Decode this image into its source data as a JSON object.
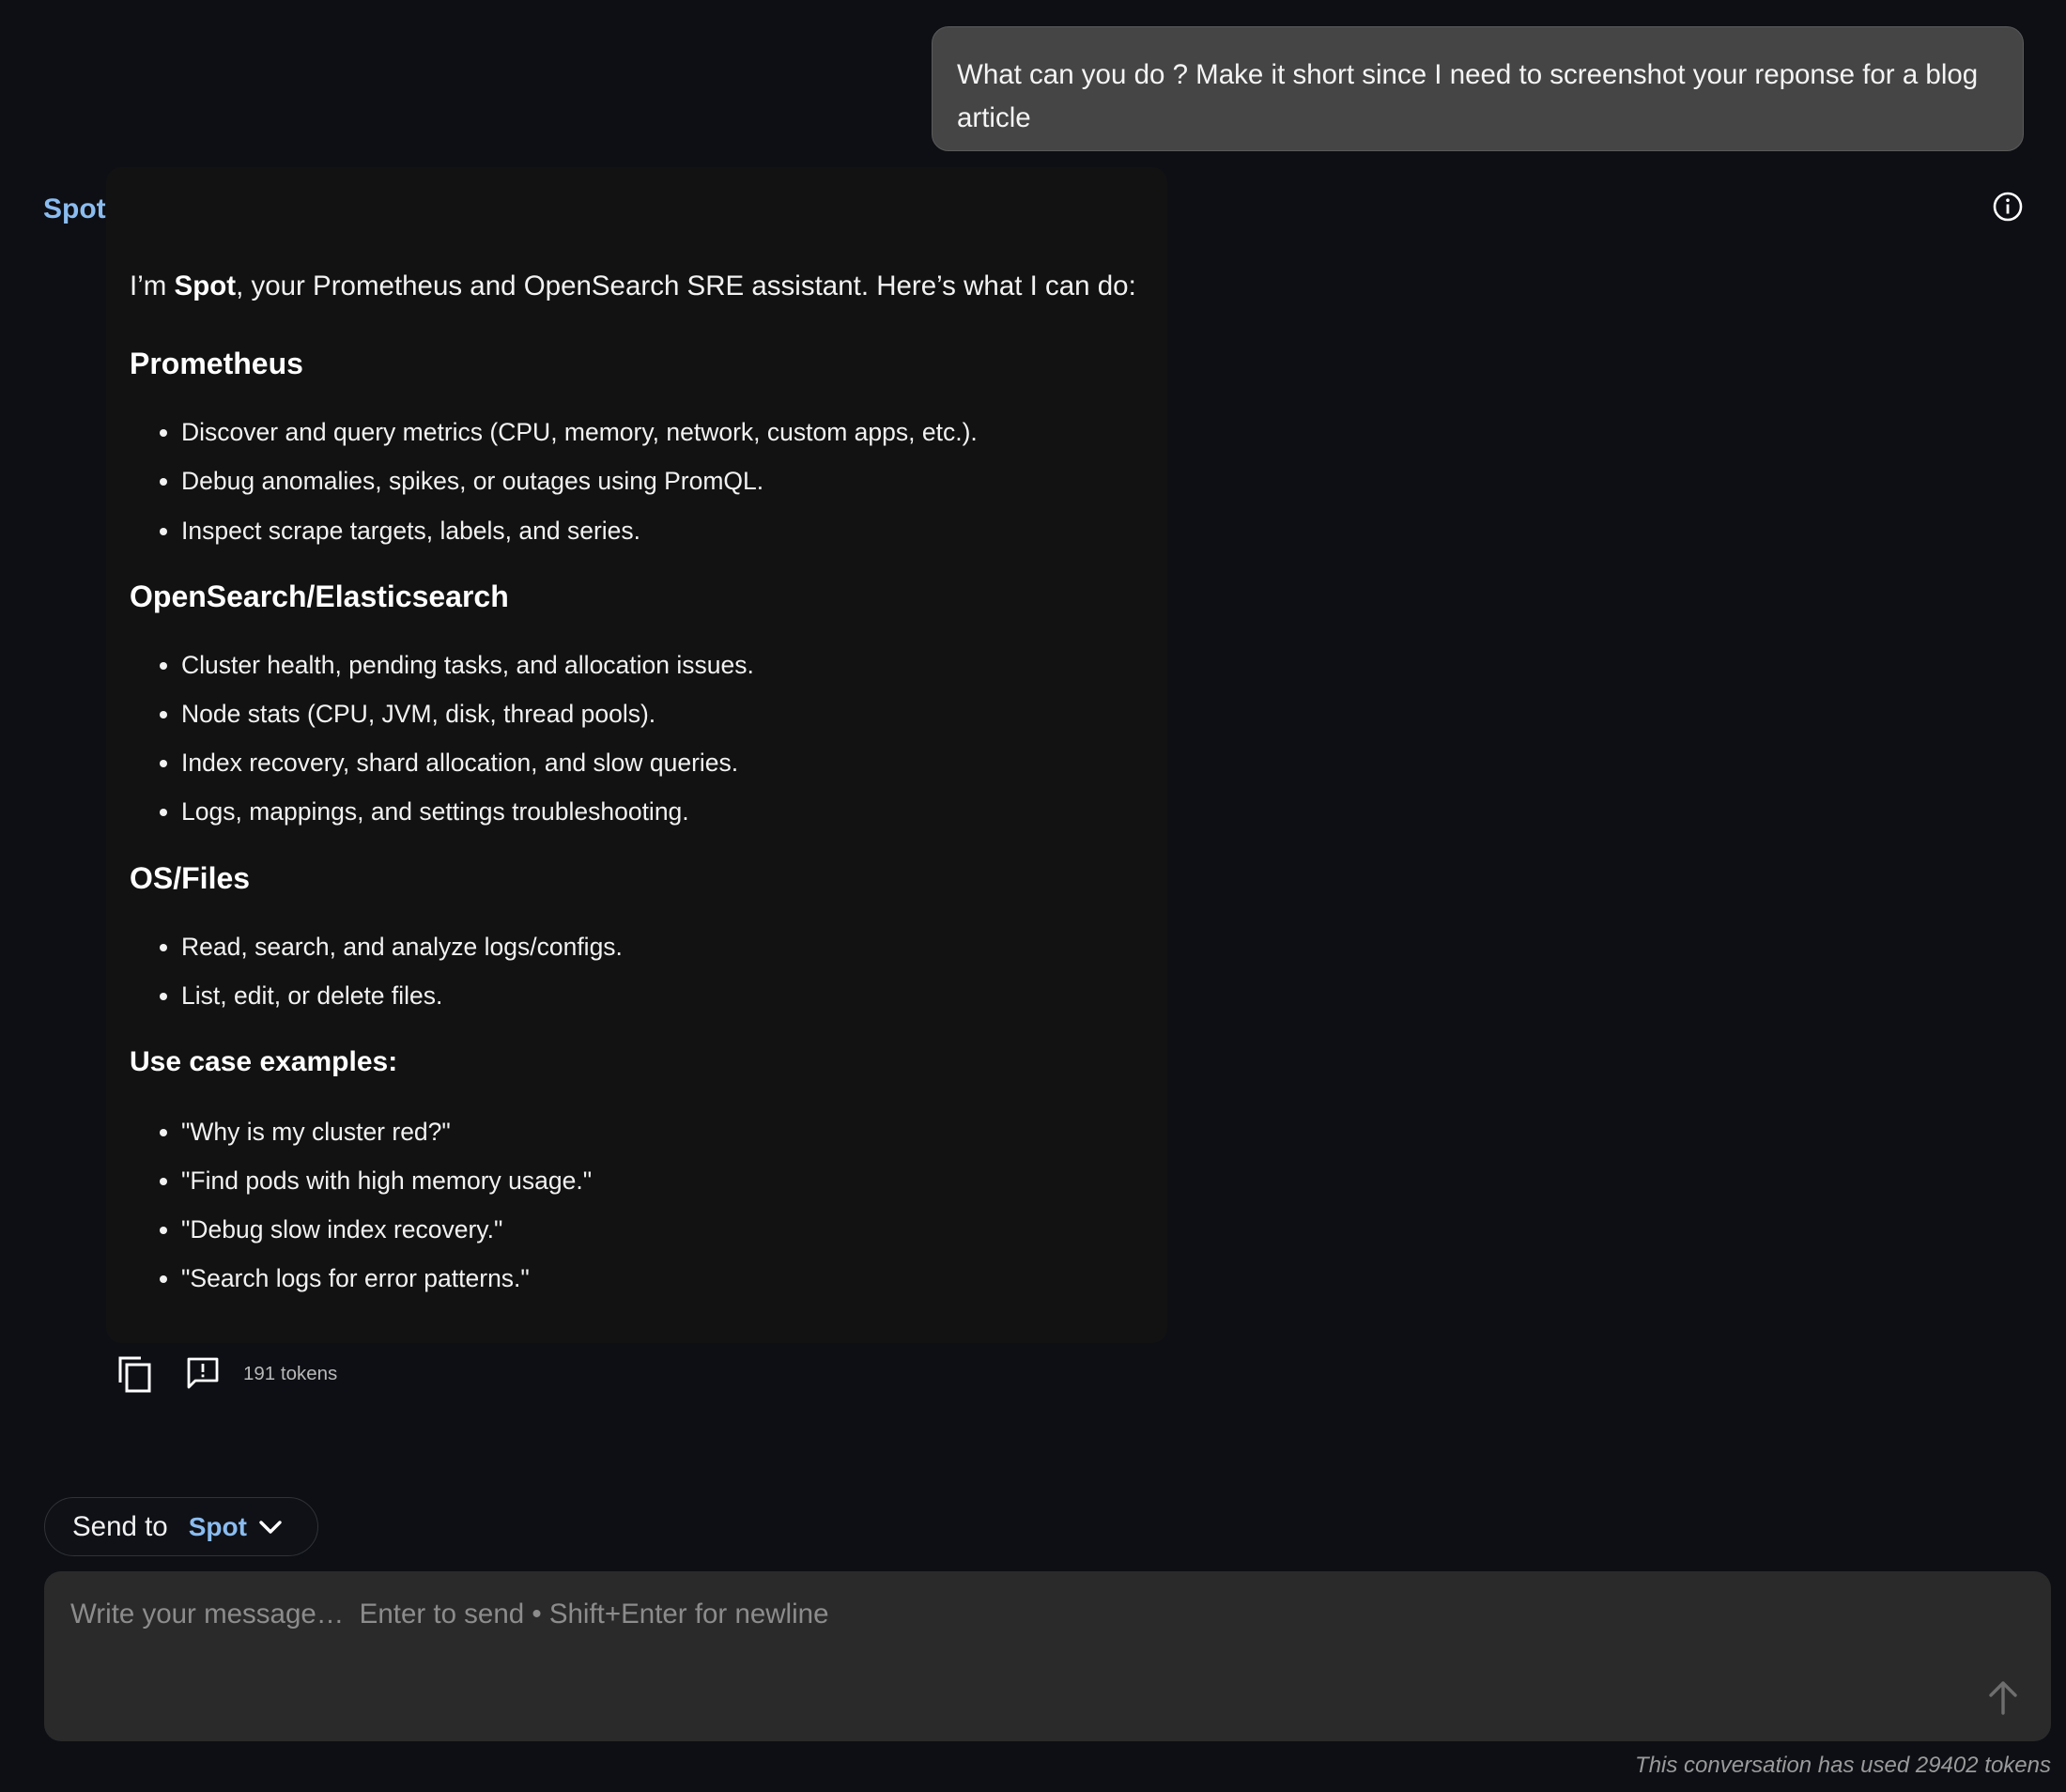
{
  "user_message": {
    "text": "What can you do ? Make it short since I need to screenshot your reponse for a blog article"
  },
  "assistant": {
    "name": "Spot",
    "intro_prefix": "I’m ",
    "intro_bold": "Spot",
    "intro_suffix": ", your Prometheus and OpenSearch SRE assistant. Here’s what I can do:",
    "sections": [
      {
        "heading": "Prometheus",
        "items": [
          "Discover and query metrics (CPU, memory, network, custom apps, etc.).",
          "Debug anomalies, spikes, or outages using PromQL.",
          "Inspect scrape targets, labels, and series."
        ]
      },
      {
        "heading": "OpenSearch/Elasticsearch",
        "items": [
          "Cluster health, pending tasks, and allocation issues.",
          "Node stats (CPU, JVM, disk, thread pools).",
          "Index recovery, shard allocation, and slow queries.",
          "Logs, mappings, and settings troubleshooting."
        ]
      },
      {
        "heading": "OS/Files",
        "items": [
          "Read, search, and analyze logs/configs.",
          "List, edit, or delete files."
        ]
      },
      {
        "heading": "Use case examples:",
        "items": [
          "\"Why is my cluster red?\"",
          "\"Find pods with high memory usage.\"",
          "\"Debug slow index recovery.\"",
          "\"Search logs for error patterns.\""
        ]
      }
    ],
    "token_label": "191 tokens"
  },
  "send_to": {
    "label": "Send to",
    "target": "Spot"
  },
  "composer": {
    "placeholder": "Write your message…  Enter to send • Shift+Enter for newline"
  },
  "footer": {
    "usage_text": "This conversation has used 29402 tokens"
  },
  "colors": {
    "background": "#0d0f14",
    "accent": "#8bbcf0",
    "card": "#121212",
    "user_bubble": "#454545",
    "composer": "#2a2a2a"
  },
  "icons": {
    "info": "info-icon",
    "copy": "copy-icon",
    "feedback": "feedback-icon",
    "chevron": "chevron-down-icon",
    "send": "arrow-up-icon"
  }
}
